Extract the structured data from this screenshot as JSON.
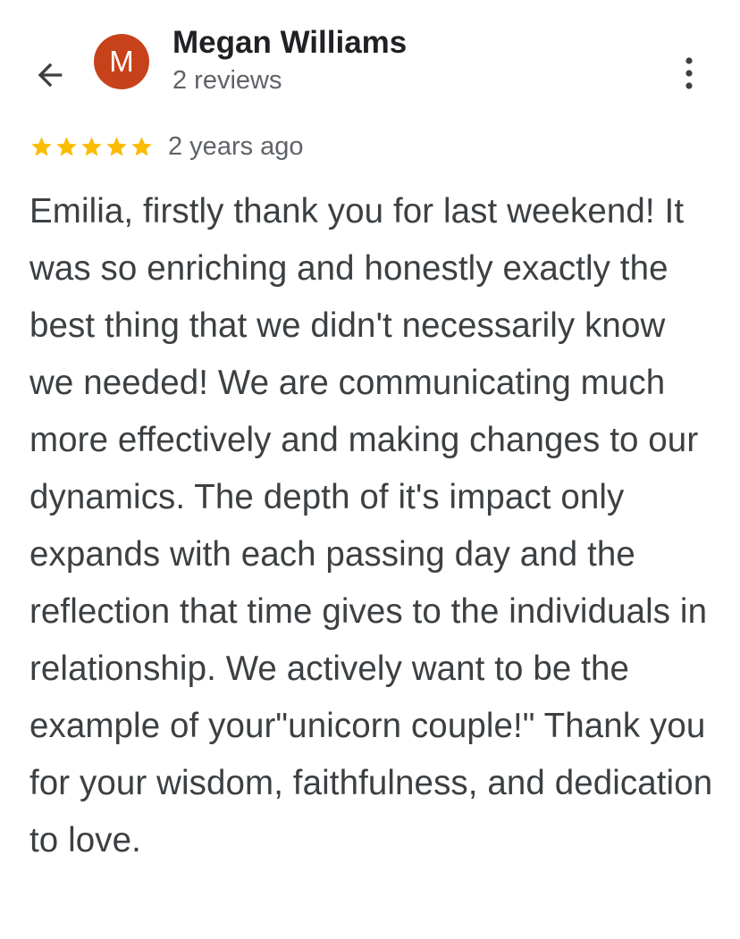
{
  "header": {
    "back_icon": "arrow-back-icon",
    "avatar_initial": "M",
    "avatar_color": "#c7421a",
    "reviewer_name": "Megan Williams",
    "review_count": "2 reviews",
    "more_icon": "more-vertical-icon"
  },
  "review": {
    "rating": 5,
    "max_rating": 5,
    "star_color": "#fbbc04",
    "date": "2 years ago",
    "text": "Emilia, firstly thank you for last weekend! It was so enriching and honestly exactly the best thing that we didn't necessarily know we needed! We are communicating much more effectively and making changes to our dynamics. The depth of it's impact only expands with each passing day and the reflection that time gives to the individuals in relationship. We actively want to be the example of your\"unicorn couple!\" Thank you for your wisdom, faithfulness, and dedication to love."
  }
}
